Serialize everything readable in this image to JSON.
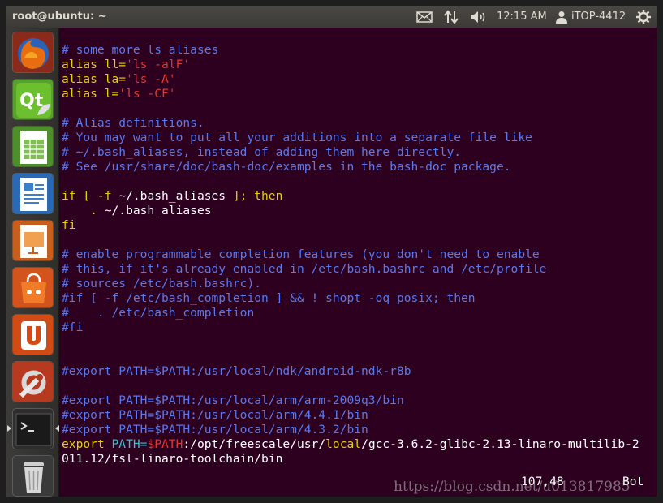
{
  "topbar": {
    "window_title": "root@ubuntu: ~",
    "clock": "12:15 AM",
    "username": "iTOP-4412",
    "icons": [
      "mail-icon",
      "network-transfer-icon",
      "volume-icon",
      "user-icon",
      "gear-icon"
    ]
  },
  "launcher": {
    "items": [
      "firefox-icon",
      "qt-creator-icon",
      "libreoffice-calc-icon",
      "libreoffice-writer-icon",
      "libreoffice-impress-icon",
      "ubuntu-software-center-icon",
      "ubuntu-one-icon",
      "system-settings-icon",
      "terminal-icon",
      "trash-icon"
    ]
  },
  "terminal": {
    "lines": [
      [
        {
          "t": "# some more ls aliases",
          "c": "comment"
        }
      ],
      [
        {
          "t": "alias ll=",
          "c": "yellow"
        },
        {
          "t": "'ls -alF'",
          "c": "string"
        }
      ],
      [
        {
          "t": "alias la=",
          "c": "yellow"
        },
        {
          "t": "'ls -A'",
          "c": "string"
        }
      ],
      [
        {
          "t": "alias l=",
          "c": "yellow"
        },
        {
          "t": "'ls -CF'",
          "c": "string"
        }
      ],
      [
        {
          "t": "",
          "c": "white"
        }
      ],
      [
        {
          "t": "# Alias definitions.",
          "c": "comment"
        }
      ],
      [
        {
          "t": "# You may want to put all your additions into a separate file like",
          "c": "comment"
        }
      ],
      [
        {
          "t": "# ~/.bash_aliases, instead of adding them here directly.",
          "c": "comment"
        }
      ],
      [
        {
          "t": "# See /usr/share/doc/bash-doc/examples in the bash-doc package.",
          "c": "comment"
        }
      ],
      [
        {
          "t": "",
          "c": "white"
        }
      ],
      [
        {
          "t": "if [ -f ",
          "c": "yellow"
        },
        {
          "t": "~/.bash_aliases",
          "c": "white"
        },
        {
          "t": " ]; then",
          "c": "yellow"
        }
      ],
      [
        {
          "t": "    . ",
          "c": "yellow"
        },
        {
          "t": "~/.bash_aliases",
          "c": "white"
        }
      ],
      [
        {
          "t": "fi",
          "c": "yellow"
        }
      ],
      [
        {
          "t": "",
          "c": "white"
        }
      ],
      [
        {
          "t": "# enable programmable completion features (you don't need to enable",
          "c": "comment"
        }
      ],
      [
        {
          "t": "# this, if it's already enabled in /etc/bash.bashrc and /etc/profile",
          "c": "comment"
        }
      ],
      [
        {
          "t": "# sources /etc/bash.bashrc).",
          "c": "comment"
        }
      ],
      [
        {
          "t": "#if [ -f /etc/bash_completion ] && ! shopt -oq posix; then",
          "c": "comment"
        }
      ],
      [
        {
          "t": "#    . /etc/bash_completion",
          "c": "comment"
        }
      ],
      [
        {
          "t": "#fi",
          "c": "comment"
        }
      ],
      [
        {
          "t": "",
          "c": "white"
        }
      ],
      [
        {
          "t": "",
          "c": "white"
        }
      ],
      [
        {
          "t": "#export PATH=$PATH:/usr/local/ndk/android-ndk-r8b",
          "c": "comment"
        }
      ],
      [
        {
          "t": "",
          "c": "white"
        }
      ],
      [
        {
          "t": "#export PATH=$PATH:/usr/local/arm/arm-2009q3/bin",
          "c": "comment"
        }
      ],
      [
        {
          "t": "#export PATH=$PATH:/usr/local/arm/4.4.1/bin",
          "c": "comment"
        }
      ],
      [
        {
          "t": "#export PATH=$PATH:/usr/local/arm/4.3.2/bin",
          "c": "comment"
        }
      ],
      [
        {
          "t": "export ",
          "c": "yellow"
        },
        {
          "t": "PATH=",
          "c": "cyan"
        },
        {
          "t": "$PATH",
          "c": "string"
        },
        {
          "t": ":/opt/freescale/usr/",
          "c": "white"
        },
        {
          "t": "local",
          "c": "yellow"
        },
        {
          "t": "/gcc-3.6.2-glibc-2.13-linaro-multilib-2",
          "c": "white"
        }
      ],
      [
        {
          "t": "011.12/fsl-linaro-toolchain/bin",
          "c": "white"
        }
      ]
    ],
    "status_position": "107,48",
    "status_scroll": "Bot"
  },
  "watermark": "https://blog.csdn.net/u013817985",
  "colors": {
    "background": "#2c001e",
    "comment": "#5c78ea",
    "yellow": "#e8d000",
    "string": "#e03535",
    "cyan": "#38c0d0"
  }
}
